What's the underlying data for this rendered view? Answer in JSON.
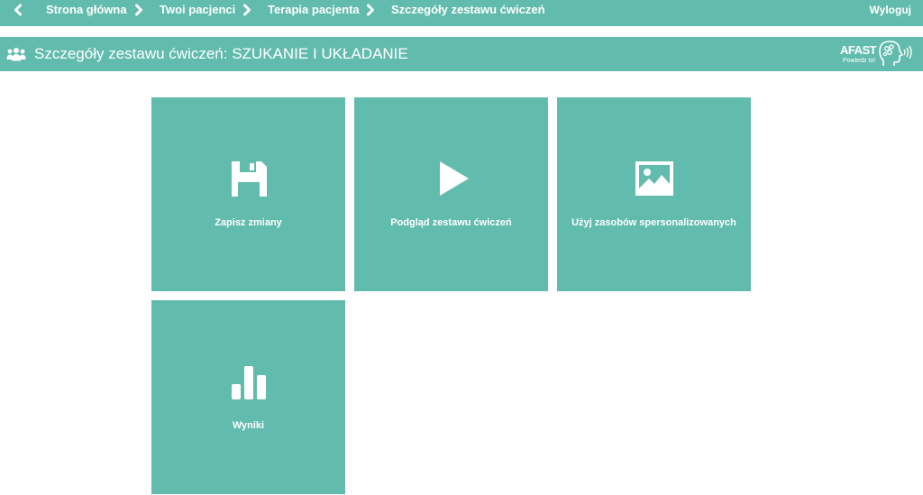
{
  "nav": {
    "back_icon": "chevron-left-icon",
    "separator_icon": "chevron-right-icon",
    "crumbs": [
      "Strona główna",
      "Twoi pacjenci",
      "Terapia pacjenta",
      "Szczegóły zestawu ćwiczeń"
    ],
    "logout_label": "Wyloguj"
  },
  "header": {
    "icon": "users-icon",
    "title": "Szczegóły zestawu ćwiczeń: SZUKANIE I UKŁADANIE",
    "logo": {
      "brand": "AFAST",
      "tagline": "Powiedz to!"
    }
  },
  "tiles": [
    {
      "icon": "floppy-disk-icon",
      "label": "Zapisz zmiany"
    },
    {
      "icon": "play-icon",
      "label": "Podgląd zestawu ćwiczeń"
    },
    {
      "icon": "image-icon",
      "label": "Użyj zasobów spersonalizowanych"
    },
    {
      "icon": "bar-chart-icon",
      "label": "Wyniki"
    }
  ],
  "colors": {
    "accent": "#62bcad",
    "text_on_accent": "#ffffff",
    "background": "#ffffff"
  }
}
